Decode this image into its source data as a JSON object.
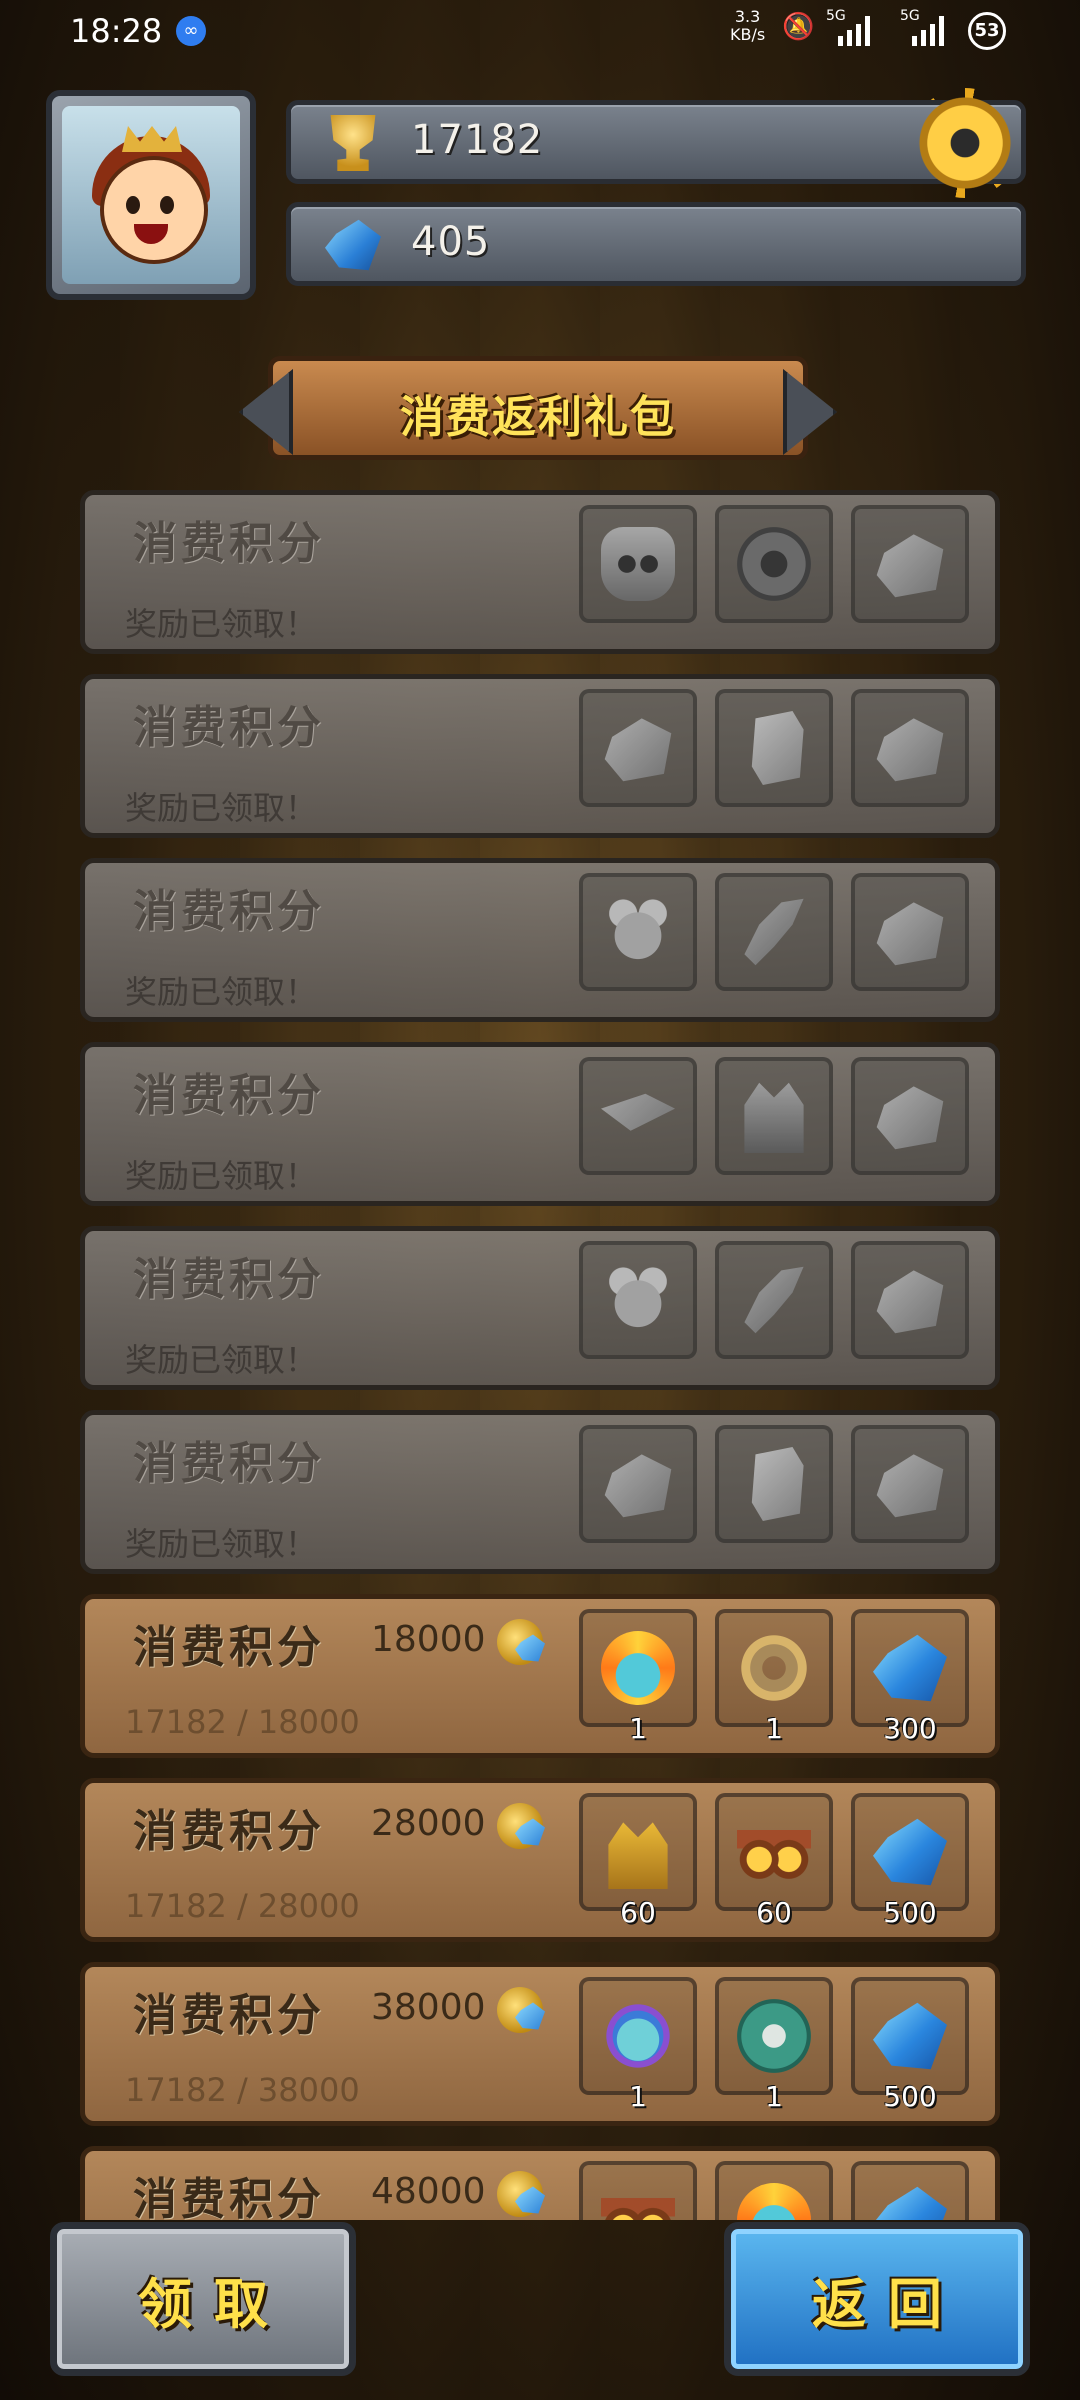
{
  "status_bar": {
    "time": "18:28",
    "net_speed_value": "3.3",
    "net_speed_unit": "KB/s",
    "signal_1_label": "5G",
    "signal_2_label": "5G",
    "battery": "53"
  },
  "header": {
    "trophy_value": "17182",
    "gem_value": "405"
  },
  "title": "消费返利礼包",
  "rows": [
    {
      "label": "消费积分",
      "status": "奖励已领取！",
      "items": [
        "mask",
        "coin",
        "rock"
      ],
      "qty": [
        "",
        "",
        ""
      ]
    },
    {
      "label": "消费积分",
      "status": "奖励已领取！",
      "items": [
        "rock",
        "crystal",
        "rock"
      ],
      "qty": [
        "",
        "",
        ""
      ]
    },
    {
      "label": "消费积分",
      "status": "奖励已领取！",
      "items": [
        "creature",
        "bird",
        "rock"
      ],
      "qty": [
        "",
        "",
        ""
      ]
    },
    {
      "label": "消费积分",
      "status": "奖励已领取！",
      "items": [
        "book",
        "armor",
        "rock"
      ],
      "qty": [
        "",
        "",
        ""
      ]
    },
    {
      "label": "消费积分",
      "status": "奖励已领取！",
      "items": [
        "creature",
        "bird",
        "rock"
      ],
      "qty": [
        "",
        "",
        ""
      ]
    },
    {
      "label": "消费积分",
      "status": "奖励已领取！",
      "items": [
        "rock",
        "crystal",
        "rock"
      ],
      "qty": [
        "",
        "",
        ""
      ]
    },
    {
      "label": "消费积分",
      "target": "18000",
      "progress": "17182 / 18000",
      "items": [
        "hero",
        "horseshoe",
        "gem"
      ],
      "qty": [
        "1",
        "1",
        "300"
      ]
    },
    {
      "label": "消费积分",
      "target": "28000",
      "progress": "17182 / 28000",
      "items": [
        "helmet",
        "goggles",
        "gem"
      ],
      "qty": [
        "60",
        "60",
        "500"
      ]
    },
    {
      "label": "消费积分",
      "target": "38000",
      "progress": "17182 / 38000",
      "items": [
        "hero2",
        "teal-coin",
        "gem"
      ],
      "qty": [
        "1",
        "1",
        "500"
      ]
    },
    {
      "label": "消费积分",
      "target": "48000",
      "progress": "",
      "items": [
        "goggles",
        "hero",
        "gem"
      ],
      "qty": [
        "",
        "",
        ""
      ]
    }
  ],
  "buttons": {
    "claim": "领取",
    "back": "返回"
  },
  "icons": {
    "trophy": "trophy-icon",
    "gem": "gem-icon",
    "settings": "gear-icon",
    "coin": "coin-gem-icon"
  },
  "colors": {
    "title_text": "#ffe35a",
    "button_text": "#ffe04a",
    "back_button": "#2f86d6",
    "claim_button": "#8a9098"
  }
}
